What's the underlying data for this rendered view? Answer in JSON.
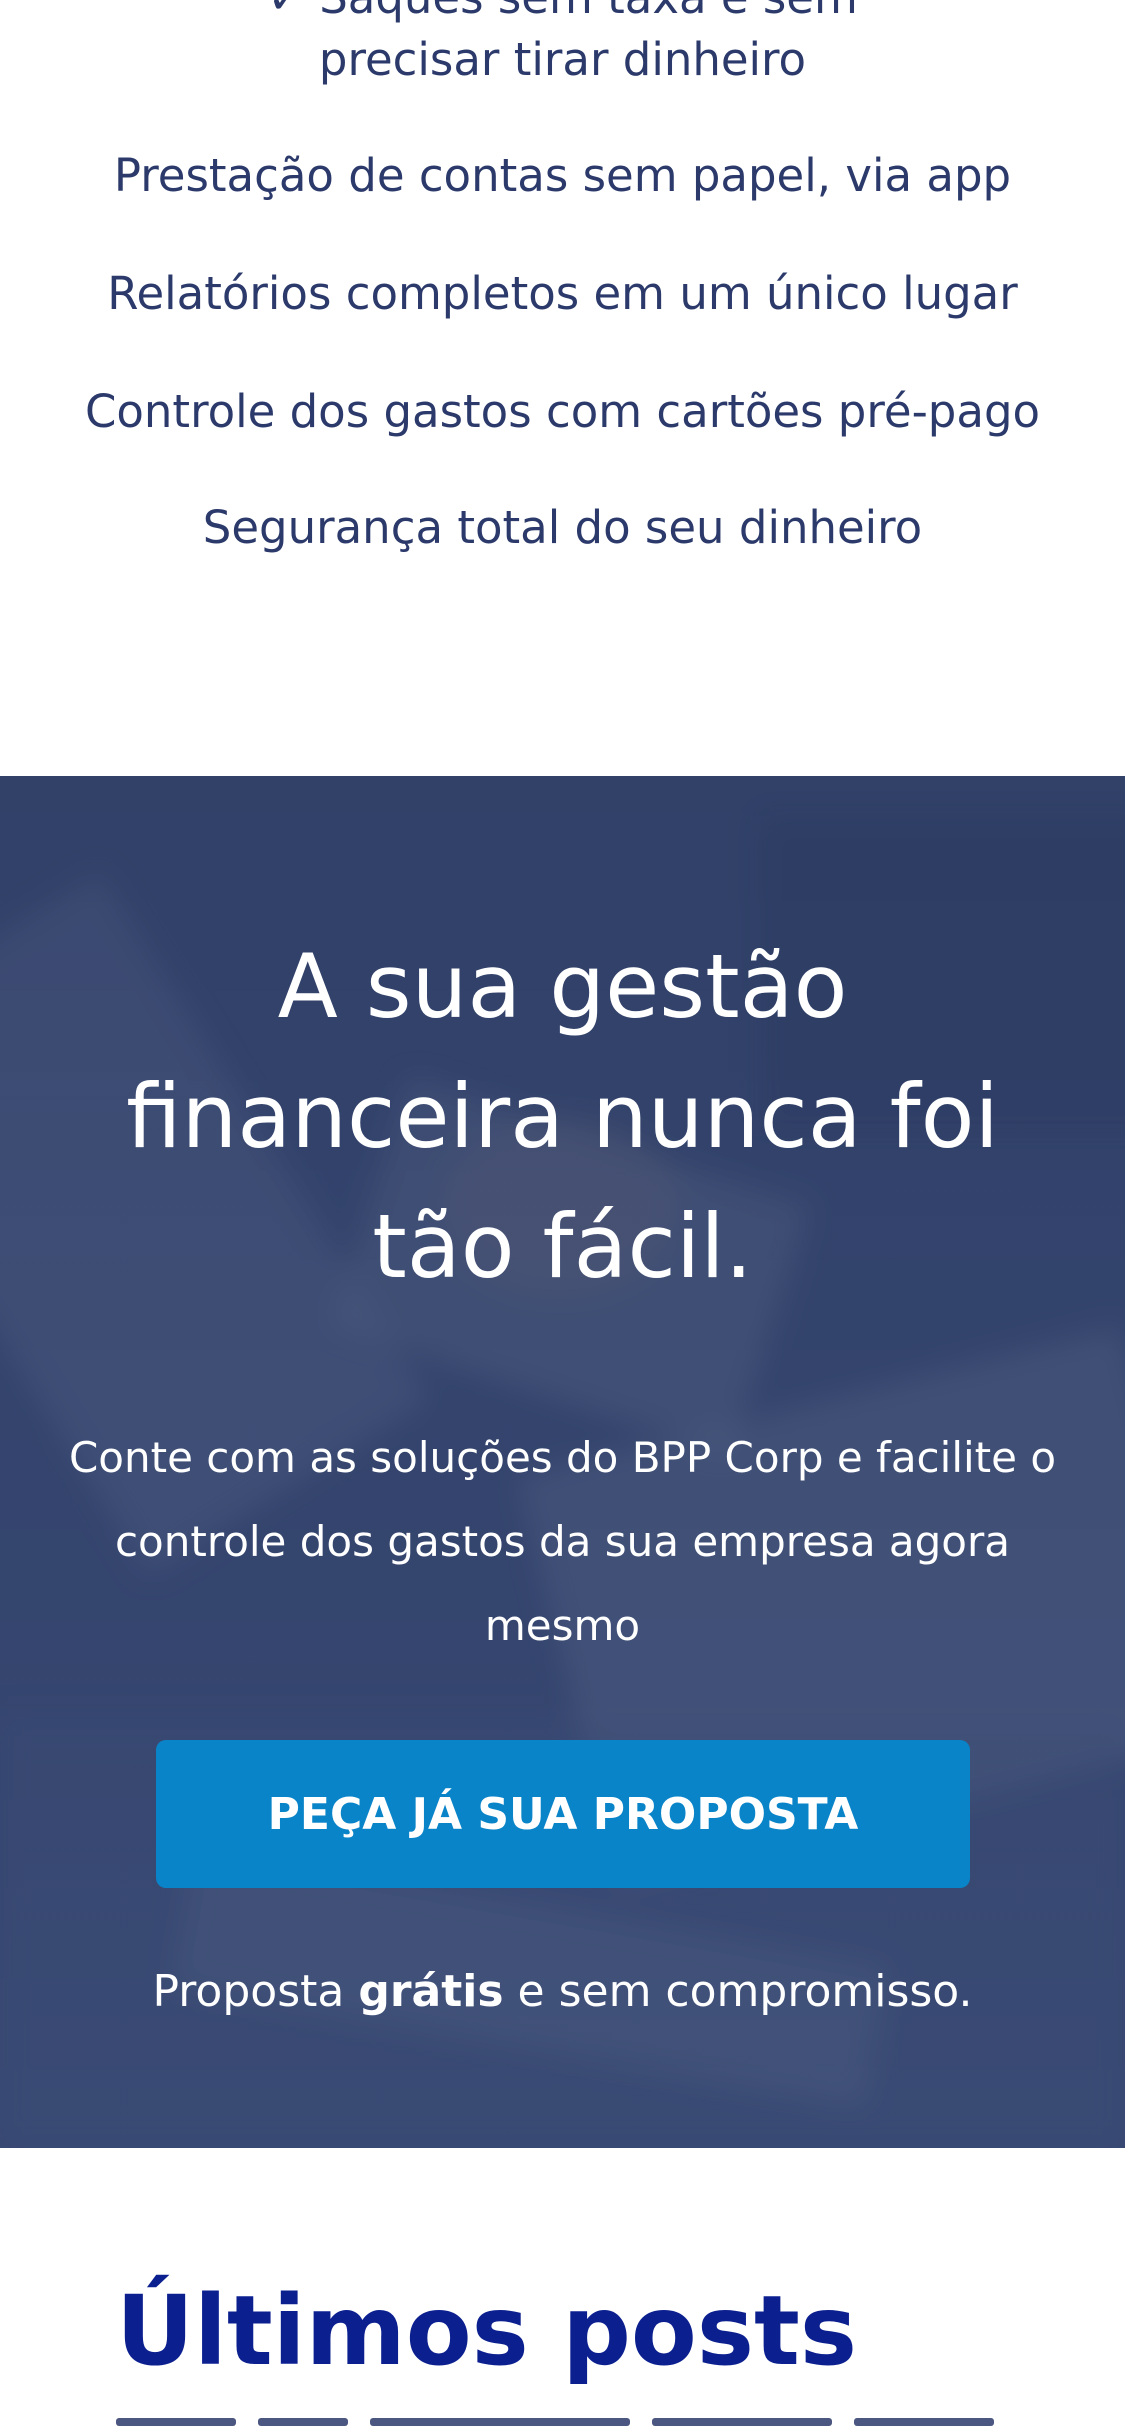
{
  "benefits": {
    "items": [
      "precisar tirar dinheiro",
      "Prestação de contas sem papel, via app",
      "Relatórios completos em um único lugar",
      "Controle dos gastos com cartões pré-pago",
      "Segurança total do seu dinheiro"
    ]
  },
  "hero": {
    "title": "A sua gestão financeira nunca foi tão fácil.",
    "description": "Conte com as soluções do BPP Corp e facilite o controle dos gastos da sua empresa agora mesmo",
    "cta_label": "PEÇA JÁ SUA PROPOSTA",
    "note_before": "Proposta ",
    "note_bold": "grátis",
    "note_after": " e sem compromisso."
  },
  "posts": {
    "title": "Últimos posts"
  },
  "colors": {
    "text_dark": "#2b3a6b",
    "hero_overlay": "#2f3f68",
    "cta": "#0a84c8",
    "posts_title": "#0b1f8f"
  }
}
